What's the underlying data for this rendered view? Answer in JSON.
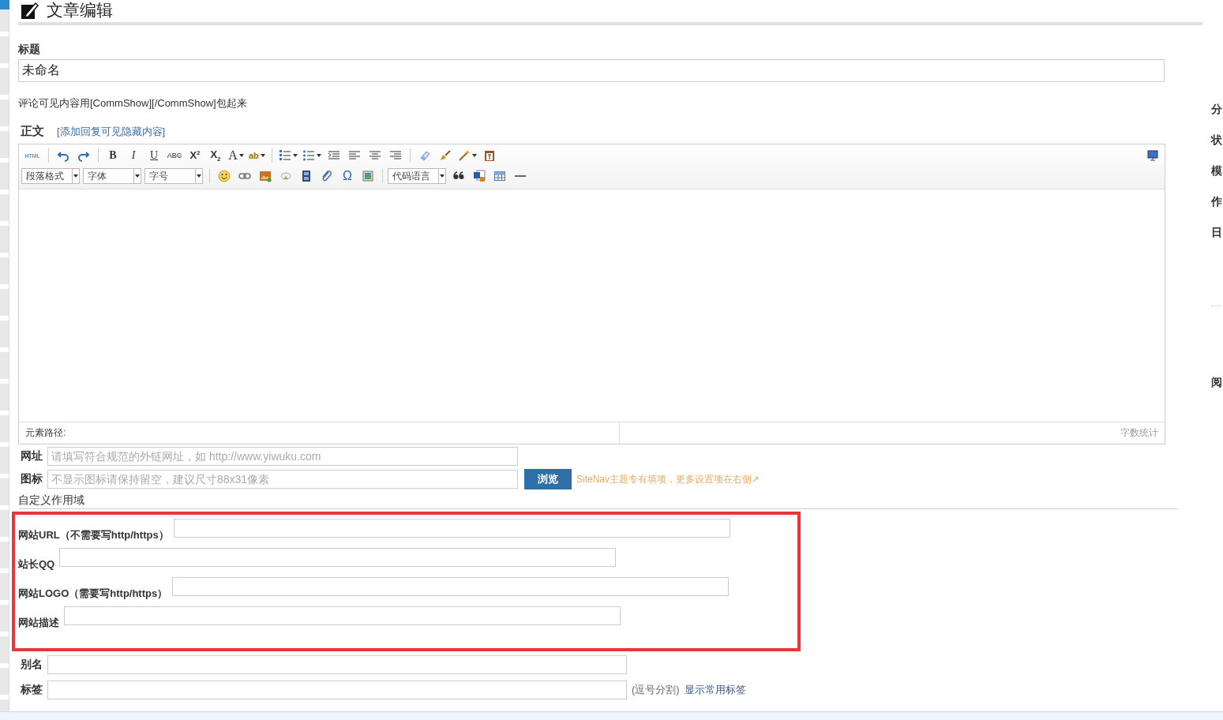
{
  "header": {
    "title": "文章编辑"
  },
  "title_field": {
    "label": "标题",
    "value": "未命名"
  },
  "hint": "评论可见内容用[CommShow][/CommShow]包起来",
  "body_heading": {
    "label": "正文",
    "link": "[添加回复可见隐藏内容]"
  },
  "editor": {
    "toolbar_rows": [
      [
        {
          "kind": "code-tag",
          "label": "HTML"
        },
        {
          "kind": "sep"
        },
        {
          "kind": "icon"
        },
        {
          "kind": "icon"
        },
        {
          "kind": "sep"
        },
        {
          "kind": "bold",
          "label": "B"
        },
        {
          "kind": "italic",
          "label": "I"
        },
        {
          "kind": "underline",
          "label": "U"
        },
        {
          "kind": "strike",
          "label": "ABC"
        },
        {
          "kind": "glyph",
          "label": "X$^{2}$"
        },
        {
          "kind": "glyph",
          "label": "X$_{2}$"
        },
        {
          "kind": "serif",
          "label": "A",
          "dropdown": true
        },
        {
          "kind": "marker",
          "label": "ab",
          "dropdown": true
        },
        {
          "kind": "sep"
        },
        {
          "kind": "icon",
          "dropdown": true
        },
        {
          "kind": "icon",
          "dropdown": true
        },
        {
          "kind": "icon"
        },
        {
          "kind": "icon"
        },
        {
          "kind": "icon"
        },
        {
          "kind": "icon"
        },
        {
          "kind": "sep"
        },
        {
          "kind": "icon"
        },
        {
          "kind": "icon"
        },
        {
          "kind": "icon",
          "dropdown": true
        },
        {
          "kind": "icon"
        }
      ],
      [
        {
          "kind": "select",
          "label": "段落格式"
        },
        {
          "kind": "select",
          "label": "字体"
        },
        {
          "kind": "select",
          "label": "字号"
        },
        {
          "kind": "sep"
        },
        {
          "kind": "icon"
        },
        {
          "kind": "icon"
        },
        {
          "kind": "icon"
        },
        {
          "kind": "icon"
        },
        {
          "kind": "icon"
        },
        {
          "kind": "icon"
        },
        {
          "kind": "omega",
          "label": "Ω"
        },
        {
          "kind": "icon"
        },
        {
          "kind": "sep"
        },
        {
          "kind": "select",
          "label": "代码语言"
        },
        {
          "kind": "icon"
        },
        {
          "kind": "icon"
        },
        {
          "kind": "icon"
        },
        {
          "kind": "icon"
        }
      ]
    ],
    "status_left": "元素路径:",
    "status_right": "字数统计"
  },
  "url_field": {
    "label": "网址",
    "placeholder": "请填写符合规范的外链网址，如 http://www.yiwuku.com"
  },
  "icon_field": {
    "label": "图标",
    "placeholder": "不显示图标请保持留空，建议尺寸88x31像素",
    "button": "浏览",
    "note": "SiteNav主题专有填项，更多设置项在右侧↗"
  },
  "custom_section": {
    "title": "自定义作用域",
    "fields": [
      {
        "label": "网站URL（不需要写http/https）"
      },
      {
        "label": "站长QQ"
      },
      {
        "label": "网站LOGO（需要写http/https）"
      },
      {
        "label": "网站描述"
      }
    ]
  },
  "alias_field": {
    "label": "别名"
  },
  "tags_field": {
    "label": "标签",
    "note": "(逗号分割)",
    "link": "显示常用标签"
  },
  "right_panel": {
    "labels": [
      "分",
      "状",
      "模",
      "作",
      "日",
      "阅"
    ]
  }
}
